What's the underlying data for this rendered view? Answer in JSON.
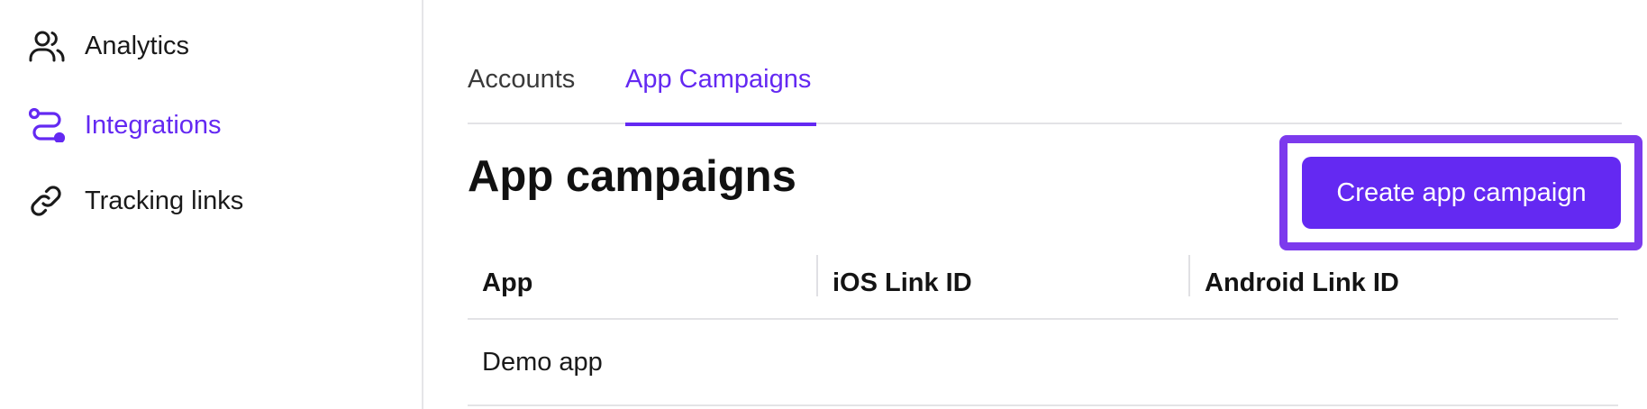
{
  "sidebar": {
    "items": [
      {
        "label": "Analytics",
        "icon": "users-icon",
        "active": false
      },
      {
        "label": "Integrations",
        "icon": "route-icon",
        "active": true
      },
      {
        "label": "Tracking links",
        "icon": "link-icon",
        "active": false
      }
    ]
  },
  "tabs": [
    {
      "label": "Accounts",
      "active": false
    },
    {
      "label": "App Campaigns",
      "active": true
    }
  ],
  "page": {
    "title": "App campaigns",
    "create_button_label": "Create app campaign"
  },
  "table": {
    "columns": [
      "App",
      "iOS Link ID",
      "Android Link ID"
    ],
    "rows": [
      {
        "app": "Demo app",
        "ios_link_id": "",
        "android_link_id": ""
      }
    ]
  },
  "colors": {
    "accent": "#6429f2",
    "highlight_frame": "#7c3aed",
    "divider": "#e3e3e6"
  }
}
